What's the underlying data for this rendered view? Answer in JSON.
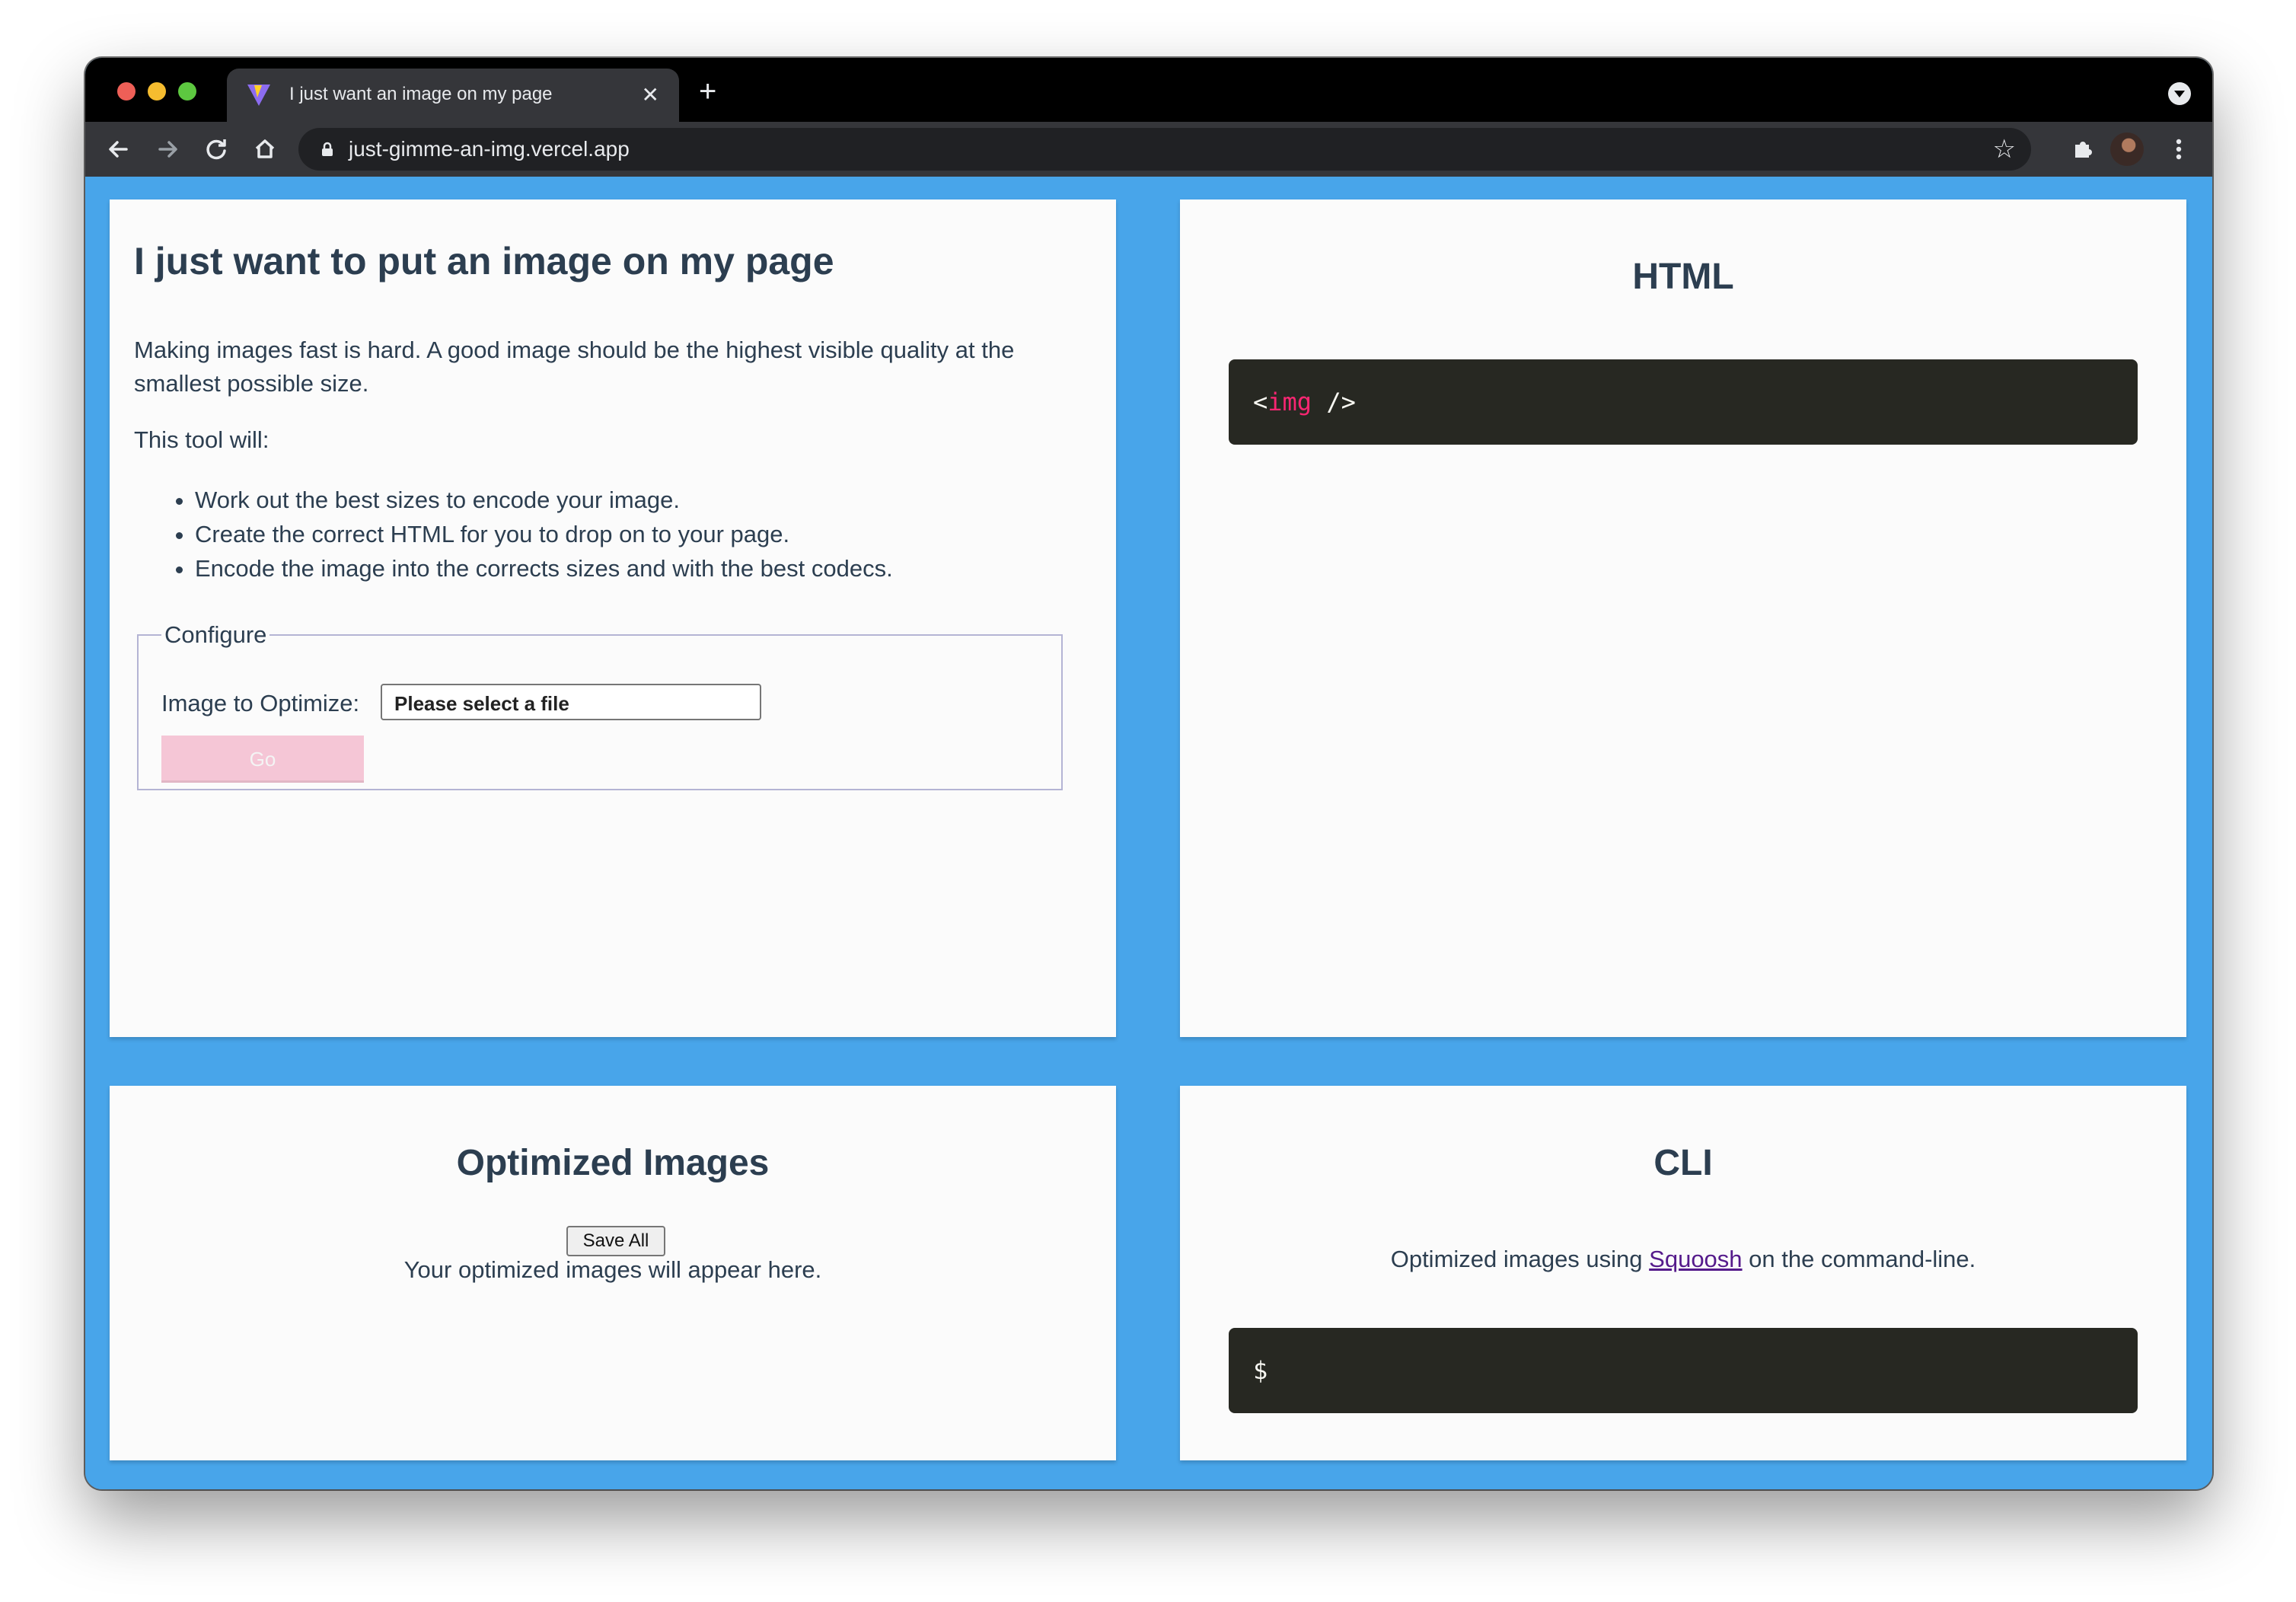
{
  "browser": {
    "tab_title": "I just want an image on my page",
    "tab_close": "✕",
    "new_tab": "+",
    "url": "just-gimme-an-img.vercel.app",
    "icons": [
      "back-icon",
      "forward-icon",
      "reload-icon",
      "home-icon",
      "lock-icon",
      "star-icon",
      "extensions-icon",
      "avatar",
      "menu-icon"
    ]
  },
  "intro_card": {
    "title": "I just want to put an image on my page",
    "intro": "Making images fast is hard. A good image should be the highest visible quality at the smallest possible size.",
    "tool_will": "This tool will:",
    "list": [
      "Work out the best sizes to encode your image.",
      "Create the correct HTML for you to drop on to your page.",
      "Encode the image into the corrects sizes and with the best codecs."
    ],
    "configure_legend": "Configure",
    "image_label": "Image to Optimize:",
    "file_button": "Please select a file",
    "go_button": "Go"
  },
  "html_card": {
    "title": "HTML",
    "code_open": "<",
    "code_tag": "img",
    "code_close": " />"
  },
  "images_card": {
    "title": "Optimized Images",
    "save_all": "Save All",
    "placeholder": "Your optimized images will appear here."
  },
  "cli_card": {
    "title": "CLI",
    "text_before": "Optimized images using ",
    "link": "Squoosh",
    "text_after": " on the command-line.",
    "prompt": "$"
  },
  "colors": {
    "page_background": "#48a5ea",
    "code_background": "#272822",
    "go_button": "#f5c6d6",
    "tag_color": "#f92672"
  }
}
